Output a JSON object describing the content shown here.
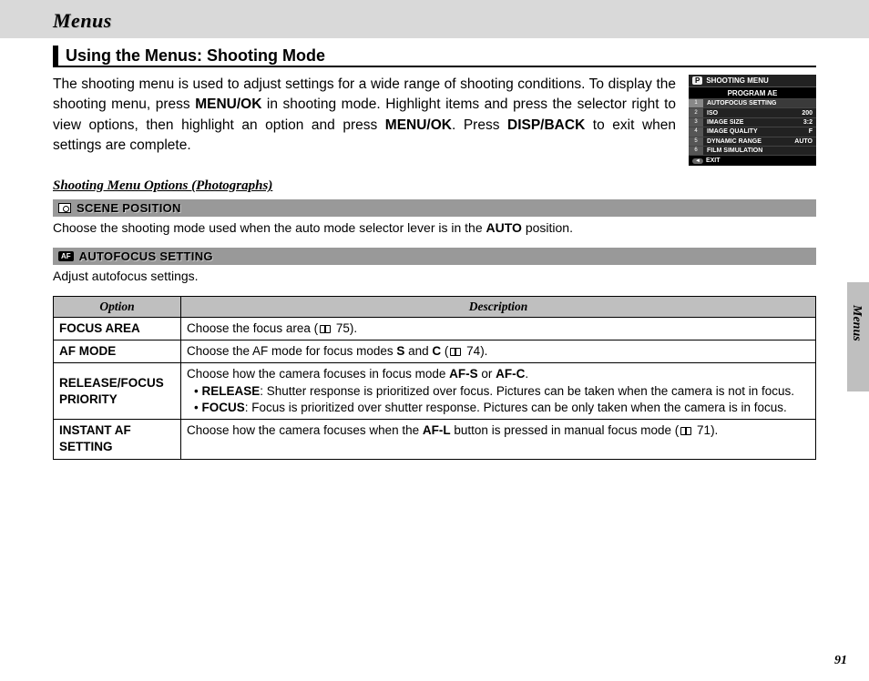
{
  "header": {
    "title": "Menus"
  },
  "section": {
    "title": "Using the Menus: Shooting Mode"
  },
  "body": {
    "p1a": "The shooting menu is used to adjust settings for a wide range of shooting conditions.  To display the shooting menu, press ",
    "b1": "MENU/OK",
    "p1b": " in shooting mode.  Highlight items and press the selector right to view options, then highlight an option and press ",
    "b2": "MENU/OK",
    "p1c": ".  Press ",
    "b3": "DISP/BACK",
    "p1d": " to exit when settings are complete."
  },
  "shot": {
    "head": "SHOOTING MENU",
    "program": "PROGRAM AE",
    "rows": [
      {
        "tab": "1",
        "label": "AUTOFOCUS SETTING",
        "val": "",
        "active": true
      },
      {
        "tab": "2",
        "label": "ISO",
        "val": "200"
      },
      {
        "tab": "3",
        "label": "IMAGE SIZE",
        "val": "3:2"
      },
      {
        "tab": "4",
        "label": "IMAGE QUALITY",
        "val": "F"
      },
      {
        "tab": "5",
        "label": "DYNAMIC RANGE",
        "val": "AUTO"
      },
      {
        "tab": "6",
        "label": "FILM SIMULATION",
        "val": ""
      }
    ],
    "exit": "EXIT"
  },
  "sub_title": "Shooting Menu Options (Photographs)",
  "opt1": {
    "header": "SCENE POSITION",
    "desc_a": "Choose the shooting mode used when the auto mode selector lever is in the ",
    "desc_b": "AUTO",
    "desc_c": " position."
  },
  "opt2": {
    "header": "AUTOFOCUS SETTING",
    "desc": "Adjust autofocus settings."
  },
  "table": {
    "h_option": "Option",
    "h_desc": "Description",
    "r1_opt": "FOCUS AREA",
    "r1_desc_a": "Choose the focus area (",
    "r1_desc_b": " 75).",
    "r2_opt": "AF MODE",
    "r2_desc_a": "Choose the AF mode for focus modes ",
    "r2_b1": "S",
    "r2_mid": " and ",
    "r2_b2": "C",
    "r2_desc_b": " (",
    "r2_desc_c": " 74).",
    "r3_opt": "RELEASE/FOCUS PRIORITY",
    "r3_l1a": "Choose how the camera focuses in focus mode ",
    "r3_b1": "AF-S",
    "r3_l1b": " or ",
    "r3_b2": "AF-C",
    "r3_l1c": ".",
    "r3_l2a": "RELEASE",
    "r3_l2b": ": Shutter response is prioritized over focus.  Pictures can be taken when the camera is not in focus.",
    "r3_l3a": "FOCUS",
    "r3_l3b": ": Focus is prioritized over shutter response.  Pictures can be only taken when the camera is in focus.",
    "r4_opt": "INSTANT AF SETTING",
    "r4_a": "Choose how the camera focuses when the ",
    "r4_b": "AF-L",
    "r4_c": " button is pressed in manual focus mode (",
    "r4_d": " 71)."
  },
  "side": {
    "label": "Menus"
  },
  "page_num": "91"
}
